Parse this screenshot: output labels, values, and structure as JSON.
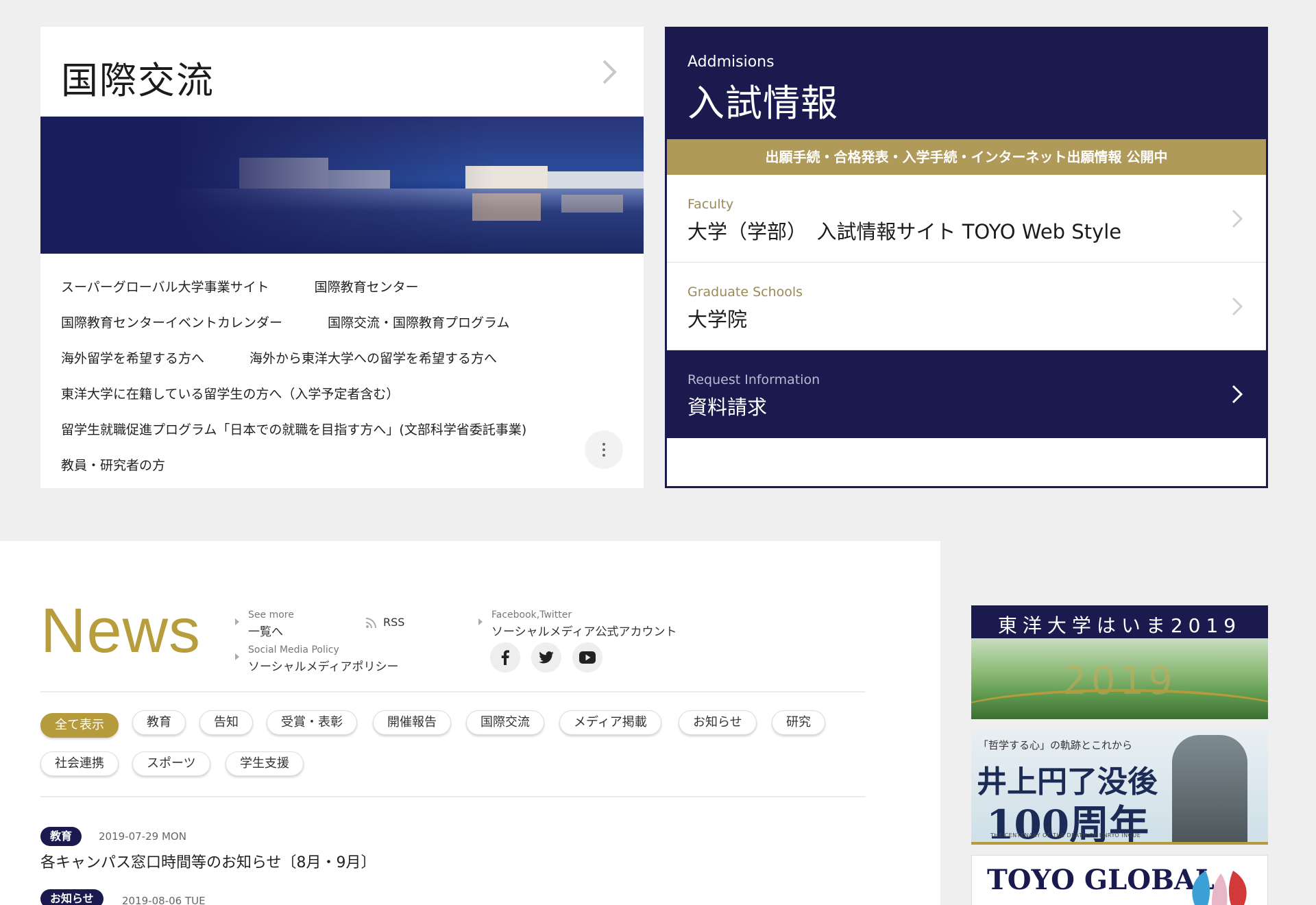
{
  "international": {
    "title": "国際交流",
    "links": [
      [
        "スーパーグローバル大学事業サイト",
        "国際教育センター"
      ],
      [
        "国際教育センターイベントカレンダー",
        "国際交流・国際教育プログラム"
      ],
      [
        "海外留学を希望する方へ",
        "海外から東洋大学への留学を希望する方へ"
      ],
      [
        "東洋大学に在籍している留学生の方へ（入学予定者含む）"
      ],
      [
        "留学生就職促進プログラム「日本での就職を目指す方へ」(文部科学省委託事業)"
      ],
      [
        "教員・研究者の方"
      ]
    ]
  },
  "admissions": {
    "subtitle": "Addmisions",
    "title": "入試情報",
    "banner": "出願手続・合格発表・入学手続・インターネット出願情報 公開中",
    "items": [
      {
        "en": "Faculty",
        "ja": "大学（学部）　入試情報サイト TOYO Web Style"
      },
      {
        "en": "Graduate Schools",
        "ja": "大学院"
      },
      {
        "en": "Request Information",
        "ja": "資料請求"
      }
    ]
  },
  "news": {
    "title": "News",
    "see_more_en": "See more",
    "see_more_ja": "一覧へ",
    "policy_en": "Social Media Policy",
    "policy_ja": "ソーシャルメディアポリシー",
    "rss": "RSS",
    "sns_en": "Facebook,Twitter",
    "sns_ja": "ソーシャルメディア公式アカウント",
    "tags_row1": [
      "全て表示",
      "教育",
      "告知",
      "受賞・表彰",
      "開催報告",
      "国際交流",
      "メディア掲載",
      "お知らせ",
      "研究"
    ],
    "tags_row2": [
      "社会連携",
      "スポーツ",
      "学生支援"
    ],
    "items": [
      {
        "badge": "教育",
        "date": "2019-07-29 MON",
        "title": "各キャンパス窓口時間等のお知らせ〔8月・9月〕"
      },
      {
        "badge": "お知らせ",
        "date": "2019-08-06 TUE",
        "title": ""
      }
    ]
  },
  "banners": {
    "b1_title": "東洋大学はいま2019",
    "b1_year": "2019",
    "b2_small": "「哲学する心」の軌跡とこれから",
    "b2_line1": "井上円了没後",
    "b2_line2": "100周年",
    "b2_sub": "THE CENTENARY OF THE DEATH OF ENRYO INOUE",
    "b3_title": "TOYO GLOBAL"
  },
  "colors": {
    "navy": "#1a1a4e",
    "gold": "#b09a5a",
    "news_gold": "#b79d3b"
  }
}
